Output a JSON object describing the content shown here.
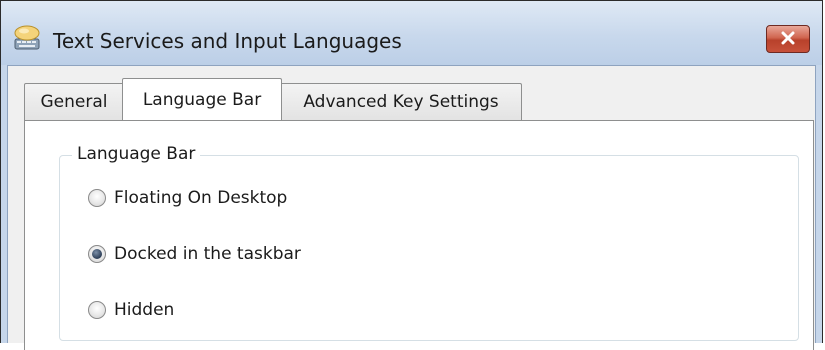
{
  "window": {
    "title": "Text Services and Input Languages",
    "close_icon": "close-icon",
    "title_icon": "keyboard-language-icon"
  },
  "tabs": [
    {
      "label": "General",
      "active": false
    },
    {
      "label": "Language Bar",
      "active": true
    },
    {
      "label": "Advanced Key Settings",
      "active": false
    }
  ],
  "language_bar_group": {
    "legend": "Language Bar",
    "options": [
      {
        "label": "Floating On Desktop",
        "checked": false
      },
      {
        "label": "Docked in the taskbar",
        "checked": true
      },
      {
        "label": "Hidden",
        "checked": false
      }
    ]
  },
  "colors": {
    "titlebar": "#c8d8ec",
    "close_button": "#c7513a",
    "tab_border": "#8e8f8f",
    "groupbox_border": "#d5dfe5"
  }
}
